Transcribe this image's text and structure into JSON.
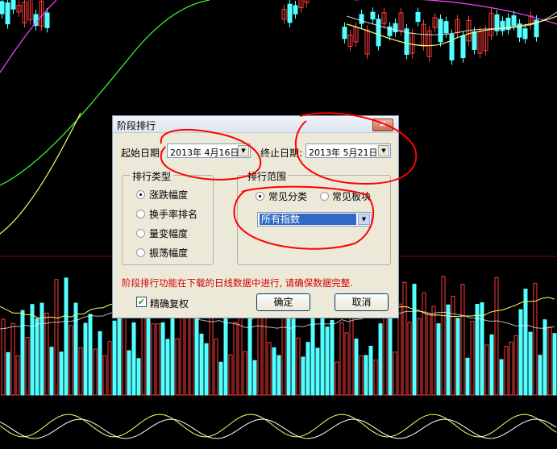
{
  "dialog": {
    "title": "阶段排行",
    "close_glyph": "✖",
    "start_date_label": "起始日期:",
    "start_date_value": "2013年  4月16日",
    "end_date_label": "终止日期:",
    "end_date_value": "2013年  5月21日",
    "rank_type": {
      "legend": "排行类型",
      "options": [
        "涨跌幅度",
        "换手率排名",
        "量变幅度",
        "振荡幅度"
      ],
      "selected": 0
    },
    "rank_range": {
      "legend": "排行范围",
      "options": [
        "常见分类",
        "常见板块"
      ],
      "selected": 0,
      "select_value": "所有指数"
    },
    "notice": "阶段排行功能在下载的日线数据中进行, 请确保数据完整.",
    "precise_label": "精确复权",
    "precise_checked": "✔",
    "ok_label": "确定",
    "cancel_label": "取消"
  },
  "colors": {
    "up_candle": "#ff3b3b",
    "down_candle": "#54ffff",
    "ma_yellow": "#ffff66",
    "ma_magenta": "#ff44ff",
    "ma_green": "#33ff33",
    "annotation_red": "#ff0000"
  },
  "icons": {
    "close": "close-icon",
    "dropdown": "chevron-down-icon",
    "check": "check-icon"
  }
}
